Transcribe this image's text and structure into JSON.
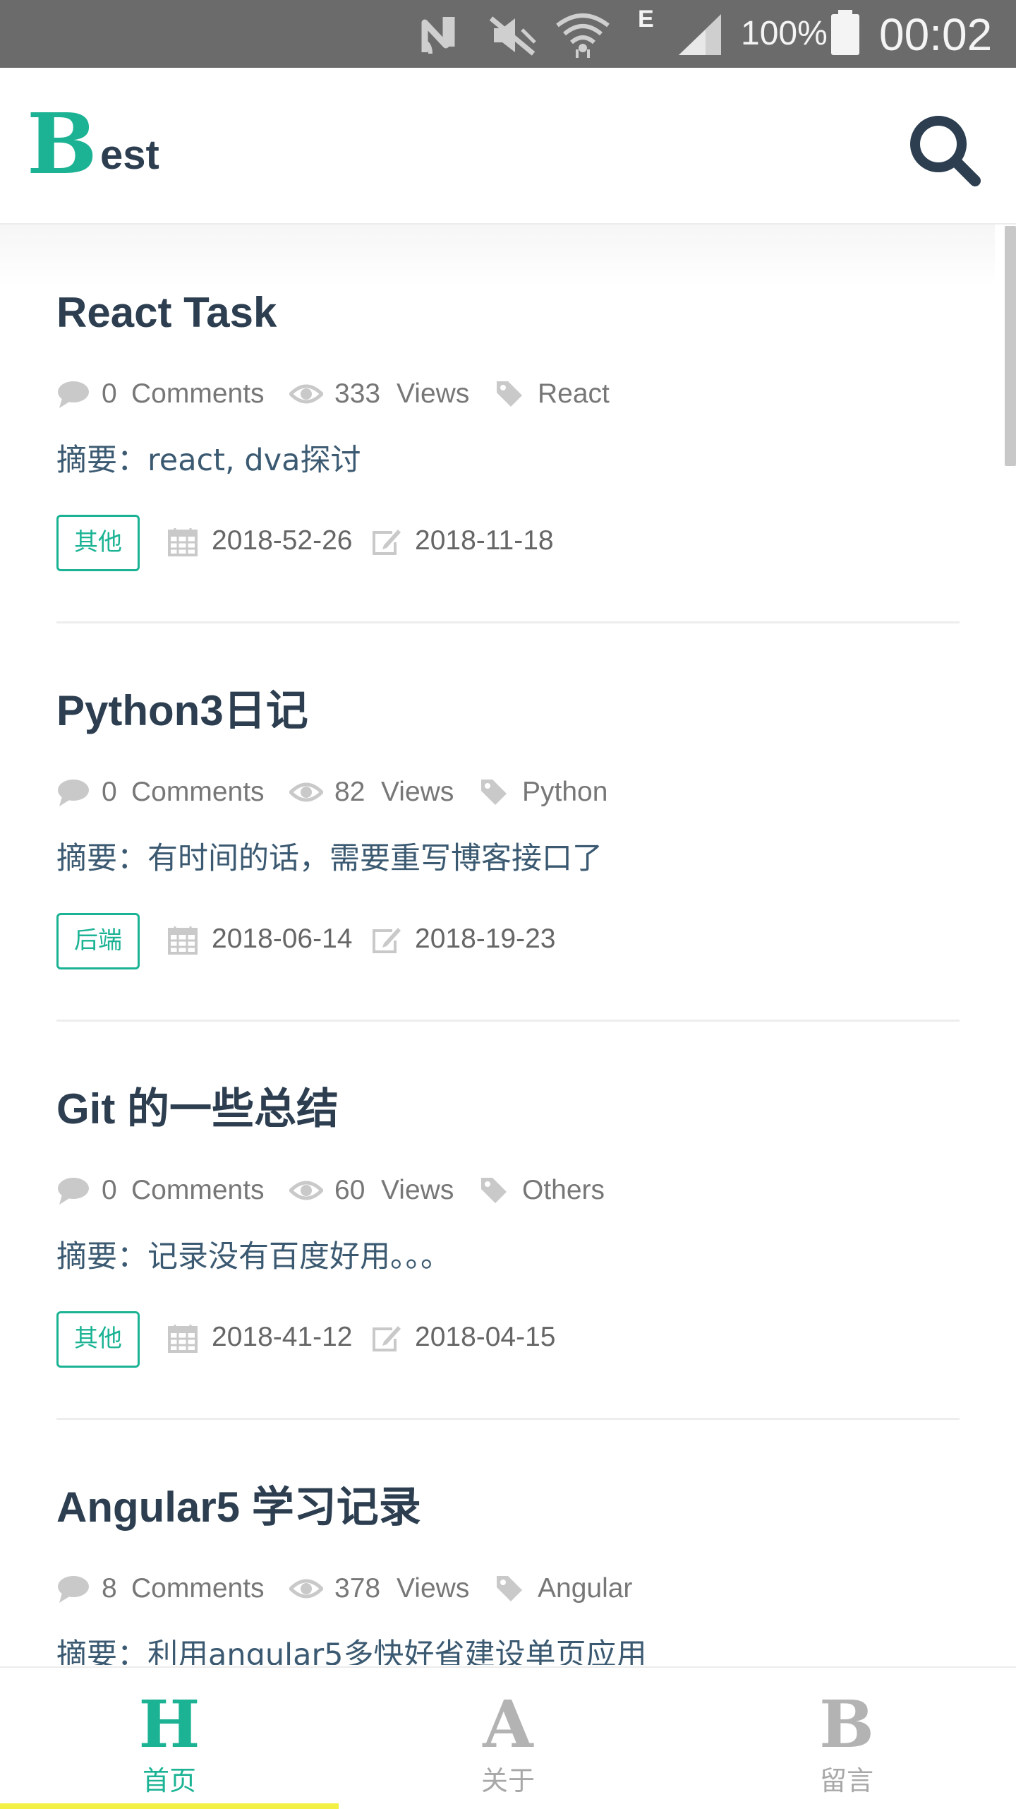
{
  "status_bar": {
    "battery": "100%",
    "time": "00:02",
    "network_letter": "E",
    "icons": [
      "nfc-icon",
      "mute-icon",
      "wifi-icon",
      "signal-icon",
      "battery-icon"
    ]
  },
  "header": {
    "logo_initial": "B",
    "logo_rest": "est",
    "search_icon": "search-icon"
  },
  "colors": {
    "accent": "#1bb394",
    "title": "#2c3e50",
    "meta": "#777777",
    "active_bar": "#f2ef45",
    "inactive_nav": "#b3b3b3",
    "status_bar": "#6b6b6b"
  },
  "posts": [
    {
      "title": "React Task",
      "comments_count": "0",
      "comments_label": "Comments",
      "views_count": "333",
      "views_label": "Views",
      "tag": "React",
      "summary": "摘要：react, dva探讨",
      "category": "其他",
      "created": "2018-52-26",
      "updated": "2018-11-18"
    },
    {
      "title": "Python3日记",
      "comments_count": "0",
      "comments_label": "Comments",
      "views_count": "82",
      "views_label": "Views",
      "tag": "Python",
      "summary": "摘要：有时间的话，需要重写博客接口了",
      "category": "后端",
      "created": "2018-06-14",
      "updated": "2018-19-23"
    },
    {
      "title": "Git 的一些总结",
      "comments_count": "0",
      "comments_label": "Comments",
      "views_count": "60",
      "views_label": "Views",
      "tag": "Others",
      "summary": "摘要：记录没有百度好用。。。",
      "category": "其他",
      "created": "2018-41-12",
      "updated": "2018-04-15"
    },
    {
      "title": "Angular5 学习记录",
      "comments_count": "8",
      "comments_label": "Comments",
      "views_count": "378",
      "views_label": "Views",
      "tag": "Angular",
      "summary": "摘要：利用angular5多快好省建设单页应用",
      "category": "",
      "created": "",
      "updated": ""
    }
  ],
  "bottom_nav": [
    {
      "letter": "H",
      "label": "首页",
      "active": true
    },
    {
      "letter": "A",
      "label": "关于",
      "active": false
    },
    {
      "letter": "B",
      "label": "留言",
      "active": false
    }
  ]
}
